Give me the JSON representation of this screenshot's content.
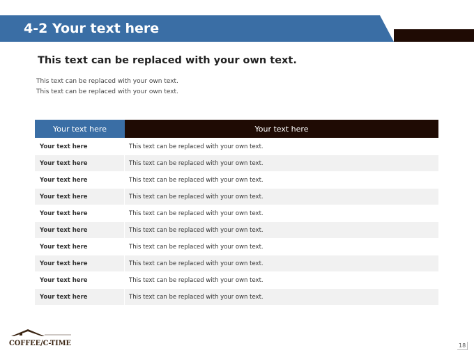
{
  "slide": {
    "title": "4-2 Your text here",
    "subtitle": "This text can be replaced with your own text.",
    "body_lines": [
      "This text can be replaced with your own text.",
      "This text can be replaced with your own text."
    ],
    "page_number": "18",
    "logo_text": "COFFEE/C-TIME"
  },
  "colors": {
    "blue": "#3a6ea5",
    "dark_brown": "#1f0b04",
    "row_alt": "#f1f1f1"
  },
  "table": {
    "headers": [
      "Your text here",
      "Your text here"
    ],
    "rows": [
      {
        "label": "Your text here",
        "text": "This text can be replaced with your own text."
      },
      {
        "label": "Your text here",
        "text": "This text can be replaced with your own text."
      },
      {
        "label": "Your text here",
        "text": "This text can be replaced with your own text."
      },
      {
        "label": "Your text here",
        "text": "This text can be replaced with your own text."
      },
      {
        "label": "Your text here",
        "text": "This text can be replaced with your own text."
      },
      {
        "label": "Your text here",
        "text": "This text can be replaced with your own text."
      },
      {
        "label": "Your text here",
        "text": "This text can be replaced with your own text."
      },
      {
        "label": "Your text here",
        "text": "This text can be replaced with your own text."
      },
      {
        "label": "Your text here",
        "text": "This text can be replaced with your own text."
      },
      {
        "label": "Your text here",
        "text": "This text can be replaced with your own text."
      }
    ]
  }
}
